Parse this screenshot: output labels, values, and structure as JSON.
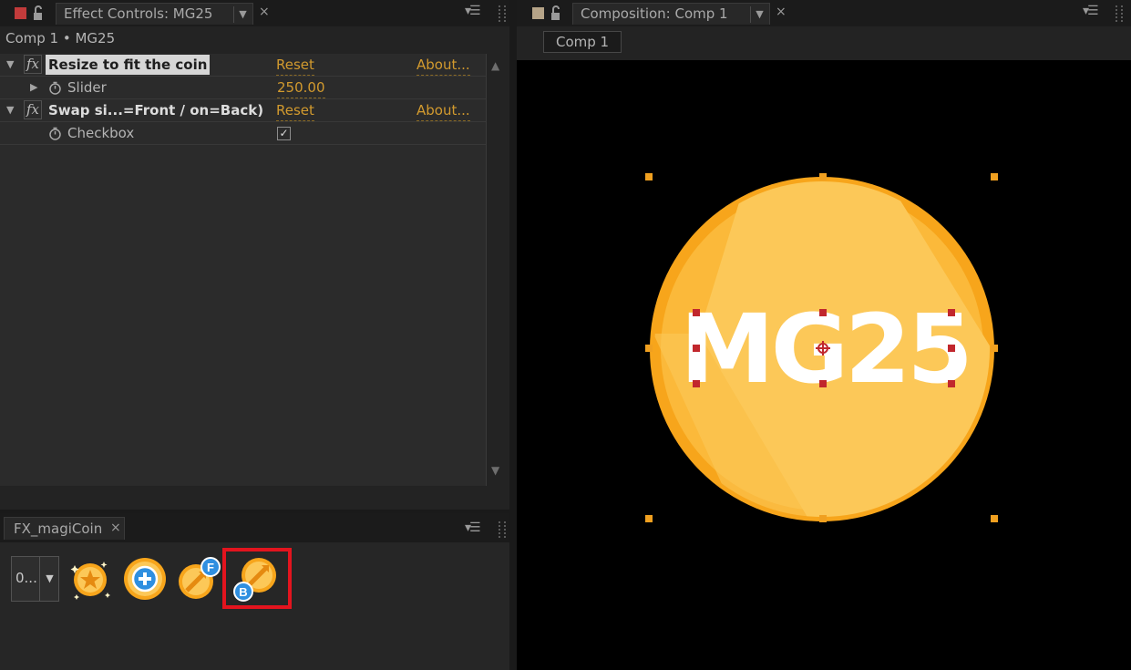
{
  "effect_controls": {
    "tab_label": "Effect Controls: MG25",
    "breadcrumb": "Comp 1 • MG25",
    "effects": [
      {
        "name": "Resize to fit the coin",
        "reset": "Reset",
        "about": "About...",
        "properties": [
          {
            "name": "Slider",
            "value": "250.00"
          }
        ]
      },
      {
        "name": "Swap si...=Front / on=Back)",
        "reset": "Reset",
        "about": "About...",
        "properties": [
          {
            "name": "Checkbox",
            "value": "✓"
          }
        ]
      }
    ]
  },
  "fx_panel": {
    "tab_label": "FX_magiCoin",
    "dropdown_value": "0...",
    "buttons": [
      {
        "icon": "coin-sparkle-icon"
      },
      {
        "icon": "coin-add-icon"
      },
      {
        "icon": "coin-front-icon",
        "badge": "F"
      },
      {
        "icon": "coin-back-icon",
        "badge": "B",
        "highlighted": true
      }
    ]
  },
  "composition": {
    "tab_label": "Composition: Comp 1",
    "comp_chip": "Comp 1",
    "coin_text": "MG25"
  },
  "colors": {
    "accent_link": "#d29a2e",
    "coin_main": "#f7a51b",
    "coin_light": "#fcc858",
    "handle_layer": "#f0a020",
    "handle_text": "#c1272d",
    "highlight": "#e3141e"
  }
}
